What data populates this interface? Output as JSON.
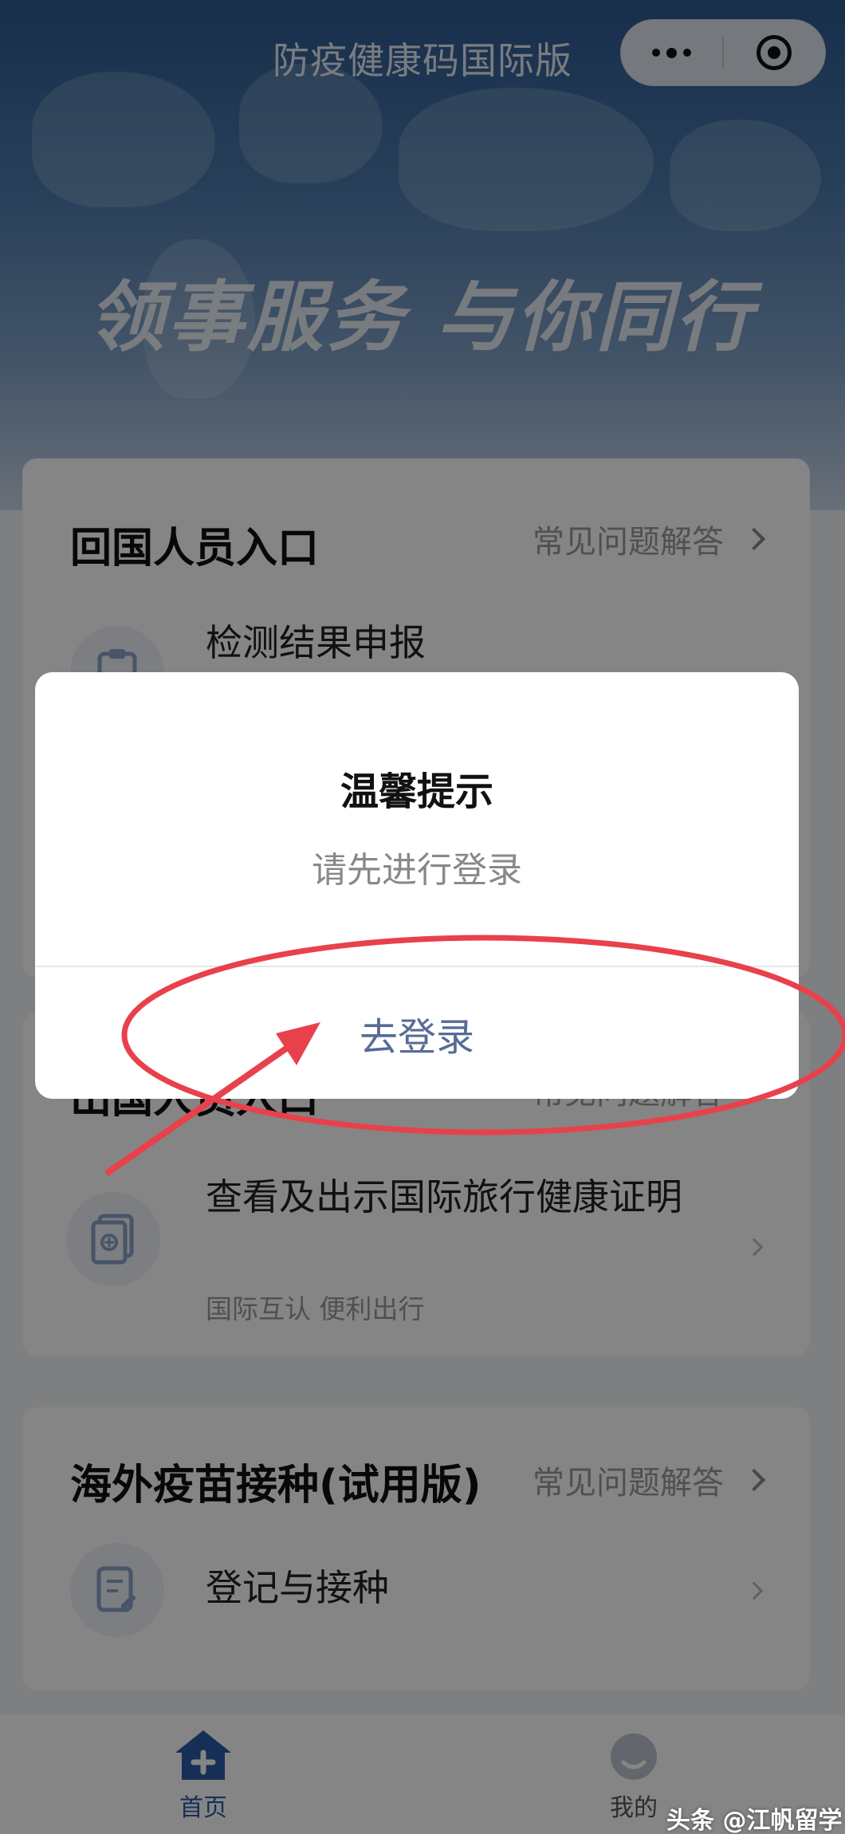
{
  "nav": {
    "title": "防疫健康码国际版"
  },
  "banner": {
    "slogan": "领事服务 与你同行"
  },
  "sections": {
    "return": {
      "heading": "回国人员入口",
      "faq": "常见问题解答",
      "items": [
        {
          "title": "检测结果申报"
        }
      ]
    },
    "exit": {
      "heading": "出国人员入口",
      "faq": "常见问题解答",
      "items": [
        {
          "title": "查看及出示国际旅行健康证明",
          "subtitle": "国际互认 便利出行"
        }
      ]
    },
    "vaccine": {
      "heading": "海外疫苗接种(试用版)",
      "faq": "常见问题解答",
      "items": [
        {
          "title": "登记与接种"
        }
      ]
    }
  },
  "tabbar": {
    "home": "首页",
    "mine": "我的"
  },
  "modal": {
    "title": "温馨提示",
    "content": "请先进行登录",
    "confirm": "去登录"
  },
  "colors": {
    "primary": "#2b5aa8",
    "link": "#576b95",
    "annotation": "#e8414b"
  },
  "watermark": "头条 @江帆留学"
}
